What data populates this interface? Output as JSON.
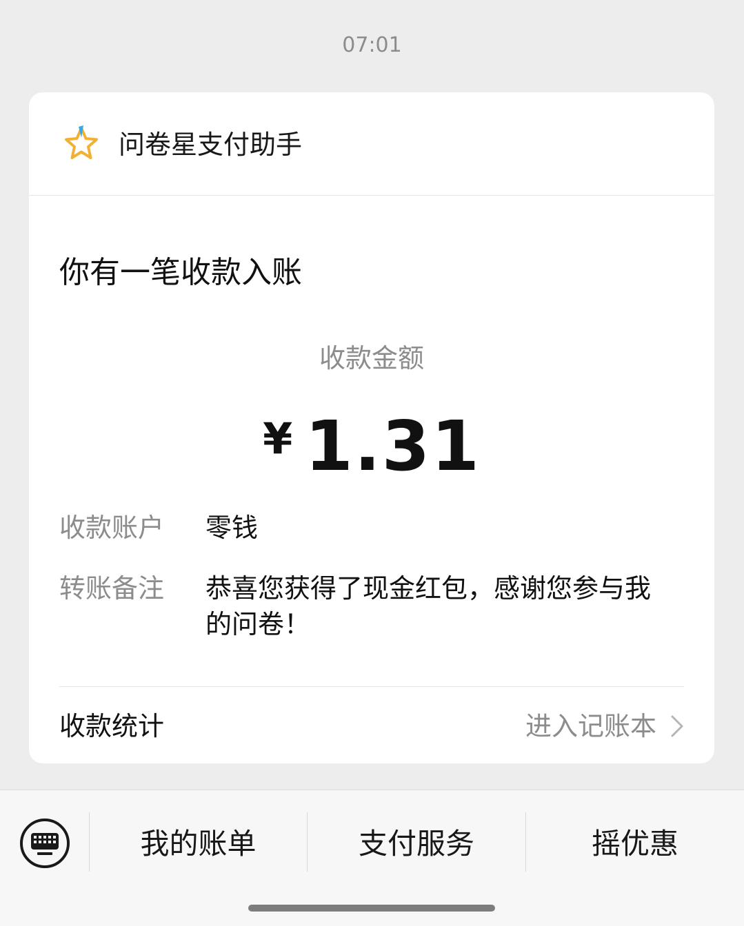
{
  "chat": {
    "timestamp": "07:01"
  },
  "card": {
    "sender": {
      "name": "问卷星支付助手",
      "icon": "star-icon"
    },
    "title": "你有一笔收款入账",
    "amount": {
      "label": "收款金额",
      "currency": "¥",
      "value": "1.31"
    },
    "details": [
      {
        "label": "收款账户",
        "value": "零钱"
      },
      {
        "label": "转账备注",
        "value": "恭喜您获得了现金红包，感谢您参与我的问卷！"
      }
    ],
    "footer": {
      "label": "收款统计",
      "link_text": "进入记账本",
      "link_icon": "chevron-right-icon"
    }
  },
  "bottom_menu": {
    "keyboard_icon": "keyboard-icon",
    "items": [
      {
        "label": "我的账单"
      },
      {
        "label": "支付服务"
      },
      {
        "label": "摇优惠"
      }
    ]
  },
  "colors": {
    "background": "#ededed",
    "card": "#ffffff",
    "secondary_text": "#8c8c8c",
    "star_gold": "#f2b134",
    "star_blue": "#3ba8e6"
  }
}
